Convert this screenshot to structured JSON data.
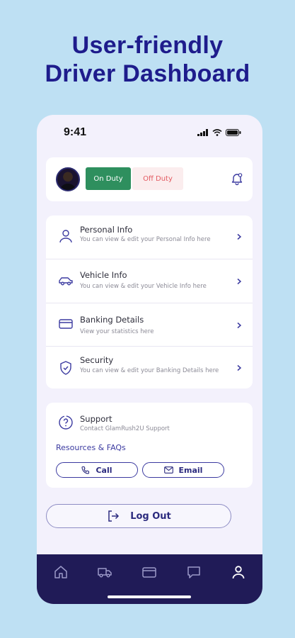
{
  "headline": {
    "line1": "User-friendly",
    "line2": "Driver Dashboard"
  },
  "status_bar": {
    "time": "9:41"
  },
  "duty": {
    "on_label": "On Duty",
    "off_label": "Off Duty"
  },
  "menu": [
    {
      "title": "Personal Info",
      "subtitle": "You can view & edit your Personal Info here",
      "icon": "user-icon"
    },
    {
      "title": "Vehicle Info",
      "subtitle": "You can view & edit your Vehicle Info here",
      "icon": "car-icon"
    },
    {
      "title": "Banking Details",
      "subtitle": "View your statistics here",
      "icon": "card-icon"
    },
    {
      "title": "Security",
      "subtitle": "You can view & edit your Banking Details here",
      "icon": "shield-icon"
    }
  ],
  "support": {
    "title": "Support",
    "subtitle": "Contact GlamRush2U Support",
    "resources_label": "Resources & FAQs",
    "call_label": "Call",
    "email_label": "Email"
  },
  "logout_label": "Log Out",
  "bottom_nav": [
    "home-icon",
    "truck-icon",
    "wallet-icon",
    "chat-icon",
    "profile-icon"
  ],
  "colors": {
    "background": "#BEE0F3",
    "accent": "#1E1C8C",
    "on_duty": "#2E8F5E",
    "off_duty_text": "#E35B62",
    "nav_bar": "#201B57"
  }
}
